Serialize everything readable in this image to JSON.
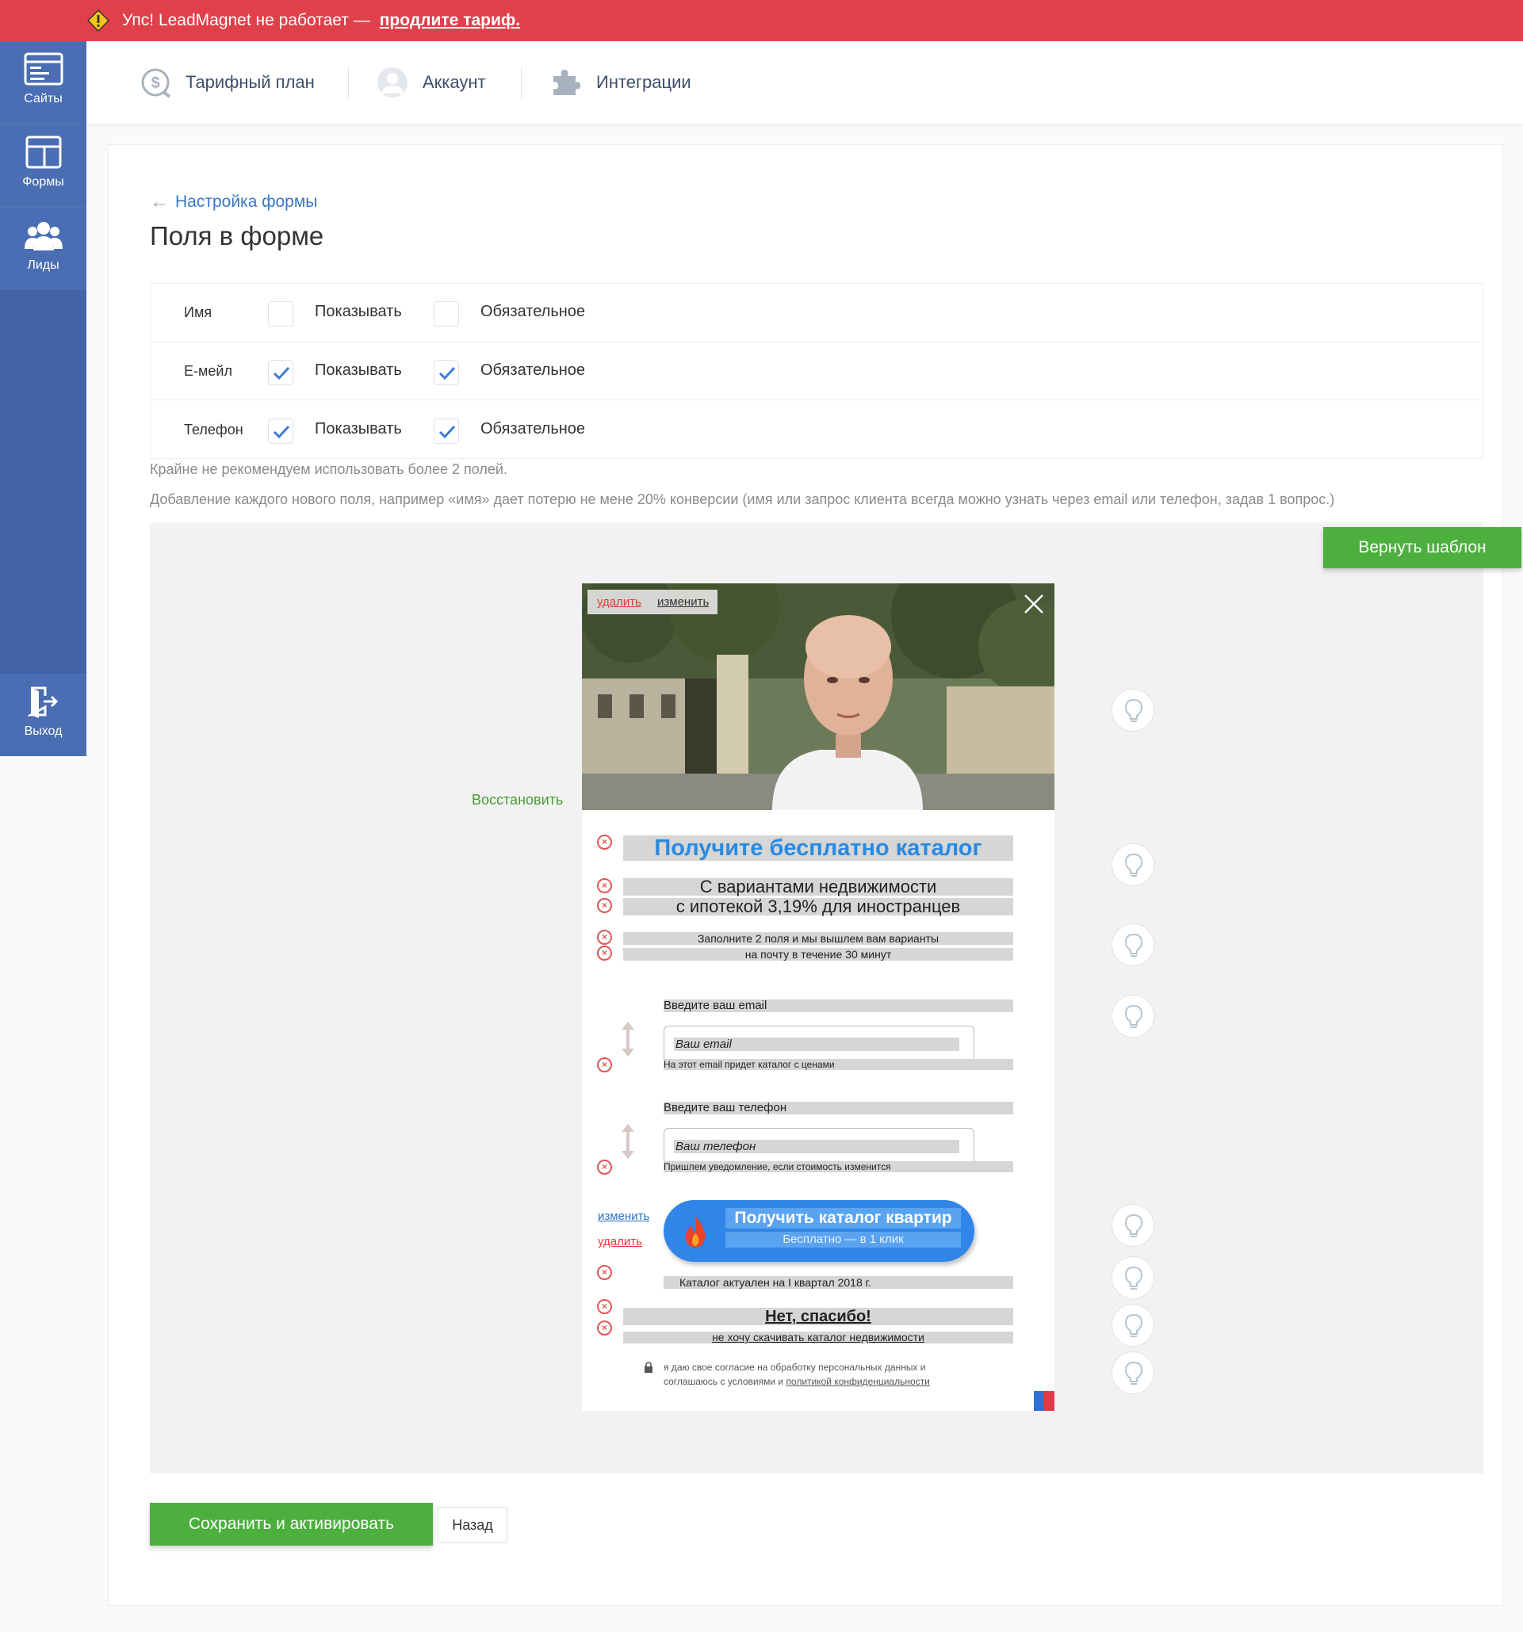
{
  "alert": {
    "text": "Упс! LeadMagnet не работает —",
    "link": "продлите тариф."
  },
  "sidebar": {
    "items": [
      {
        "label": "Сайты"
      },
      {
        "label": "Формы"
      },
      {
        "label": "Лиды"
      }
    ],
    "logout": "Выход"
  },
  "topnav": {
    "items": [
      {
        "label": "Тарифный план"
      },
      {
        "label": "Аккаунт"
      },
      {
        "label": "Интеграции"
      }
    ]
  },
  "page": {
    "back_label": "Настройка формы",
    "title": "Поля в форме"
  },
  "fields": {
    "show_label": "Показывать",
    "required_label": "Обязательное",
    "rows": [
      {
        "name": "Имя",
        "show": false,
        "required": false
      },
      {
        "name": "Е-мейл",
        "show": true,
        "required": true
      },
      {
        "name": "Телефон",
        "show": true,
        "required": true
      }
    ]
  },
  "hints": [
    "Крайне не рекомендуем использовать более 2 полей.",
    "Добавление каждого нового поля, например «имя» дает потерю не мене 20% конверсии (имя или запрос клиента всегда можно узнать через email или телефон, задав 1 вопрос.)"
  ],
  "preview": {
    "reset_button": "Вернуть шаблон",
    "restore": "Восстановить",
    "photo_delete": "удалить",
    "photo_edit": "изменить",
    "headline": "Получите бесплатно каталог",
    "sub1": "С вариантами недвижимости",
    "sub2": "с ипотекой 3,19% для иностранцев",
    "sub3": "Заполните 2 поля и мы вышлем вам варианты",
    "sub4": "на почту в течение 30 минут",
    "email_label": "Введите ваш email",
    "email_placeholder": "Ваш email",
    "email_help": "На этот email придет каталог с ценами",
    "phone_label": "Введите ваш телефон",
    "phone_placeholder": "Ваш телефон",
    "phone_help": "Пришлем уведомление, если стоимость изменится",
    "cta_edit": "изменить",
    "cta_delete": "удалить",
    "cta_title": "Получить каталог квартир",
    "cta_sub": "Бесплатно — в 1 клик",
    "actual": "Каталог актуален на I квартал 2018 г.",
    "no_thanks": "Нет, спасибо!",
    "no_thanks_sub": "не хочу скачивать каталог недвижимости",
    "consent_1": "я даю свое согласие на обработку персональных данных и",
    "consent_2": "соглашаюсь с условиями и",
    "consent_link": "политикой конфиденциальности"
  },
  "buttons": {
    "save": "Сохранить и активировать",
    "back": "Назад"
  },
  "colors": {
    "alert": "#e0404a",
    "sidebar": "#4263a7",
    "green": "#4caf3e",
    "link": "#3a78c4",
    "headline": "#2a8ae0",
    "cta": "#2f86e8",
    "remove": "#e25555"
  }
}
